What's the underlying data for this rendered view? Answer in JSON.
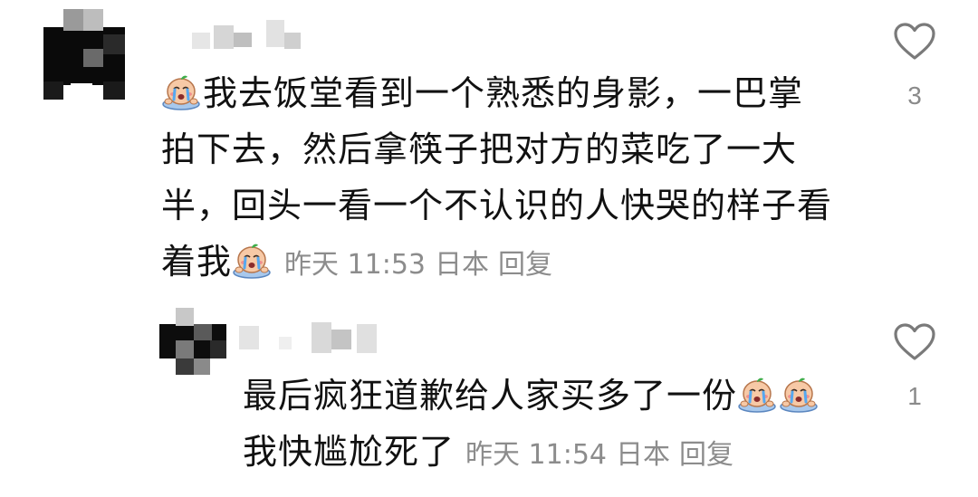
{
  "comments": [
    {
      "lines": [
        "我去饭堂看到一个熟悉的身影，一巴掌",
        "拍下去，然后拿筷子把对方的菜吃了一大",
        "半，回头一看一个不认识的人快哭的样子看",
        "着我"
      ],
      "time": "昨天 11:53",
      "location": "日本",
      "reply_label": "回复",
      "like_count": "3",
      "emoji_icon": "crying-face-icon"
    },
    {
      "lines": [
        "最后疯狂道歉给人家买多了一份",
        "我快尴尬死了"
      ],
      "time": "昨天 11:54",
      "location": "日本",
      "reply_label": "回复",
      "like_count": "1",
      "emoji_icon": "crying-face-icon"
    }
  ],
  "colors": {
    "text": "#111111",
    "meta": "#8c8c8c",
    "like_icon": "#7a7a7a"
  }
}
